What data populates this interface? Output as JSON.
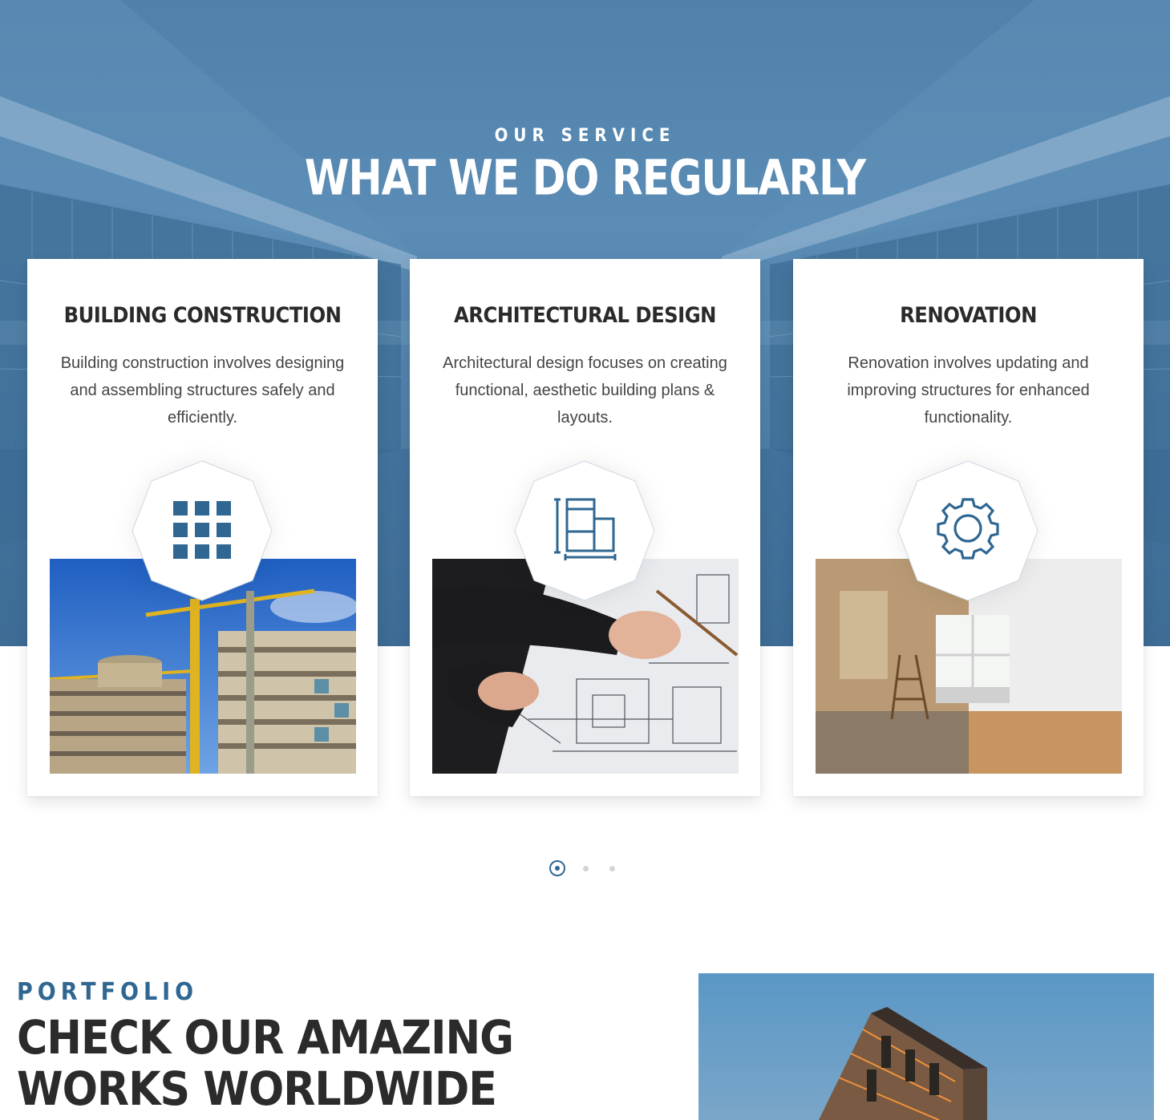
{
  "services": {
    "eyebrow": "OUR SERVICE",
    "headline": "WHAT WE DO REGULARLY",
    "cards": [
      {
        "title": "BUILDING CONSTRUCTION",
        "description": "Building construction involves designing and assembling structures safely and efficiently.",
        "icon": "grid-icon",
        "photo": "construction-site-photo"
      },
      {
        "title": "ARCHITECTURAL DESIGN",
        "description": "Architectural design focuses on creating functional, aesthetic building plans & layouts.",
        "icon": "floor-plan-icon",
        "photo": "blueprint-drawing-photo"
      },
      {
        "title": "RENOVATION",
        "description": "Renovation involves updating and improving structures for enhanced functionality.",
        "icon": "gear-icon",
        "photo": "room-renovation-photo"
      }
    ],
    "pager": {
      "count": 3,
      "active": 1
    }
  },
  "portfolio": {
    "eyebrow": "PORTFOLIO",
    "title": "CHECK OUR AMAZING WORKS WORLDWIDE"
  },
  "colors": {
    "accent": "#2f6792",
    "icon": "#2f6792",
    "hero_bg": "#4f81aa",
    "heading_dark": "#2b2b2b"
  }
}
